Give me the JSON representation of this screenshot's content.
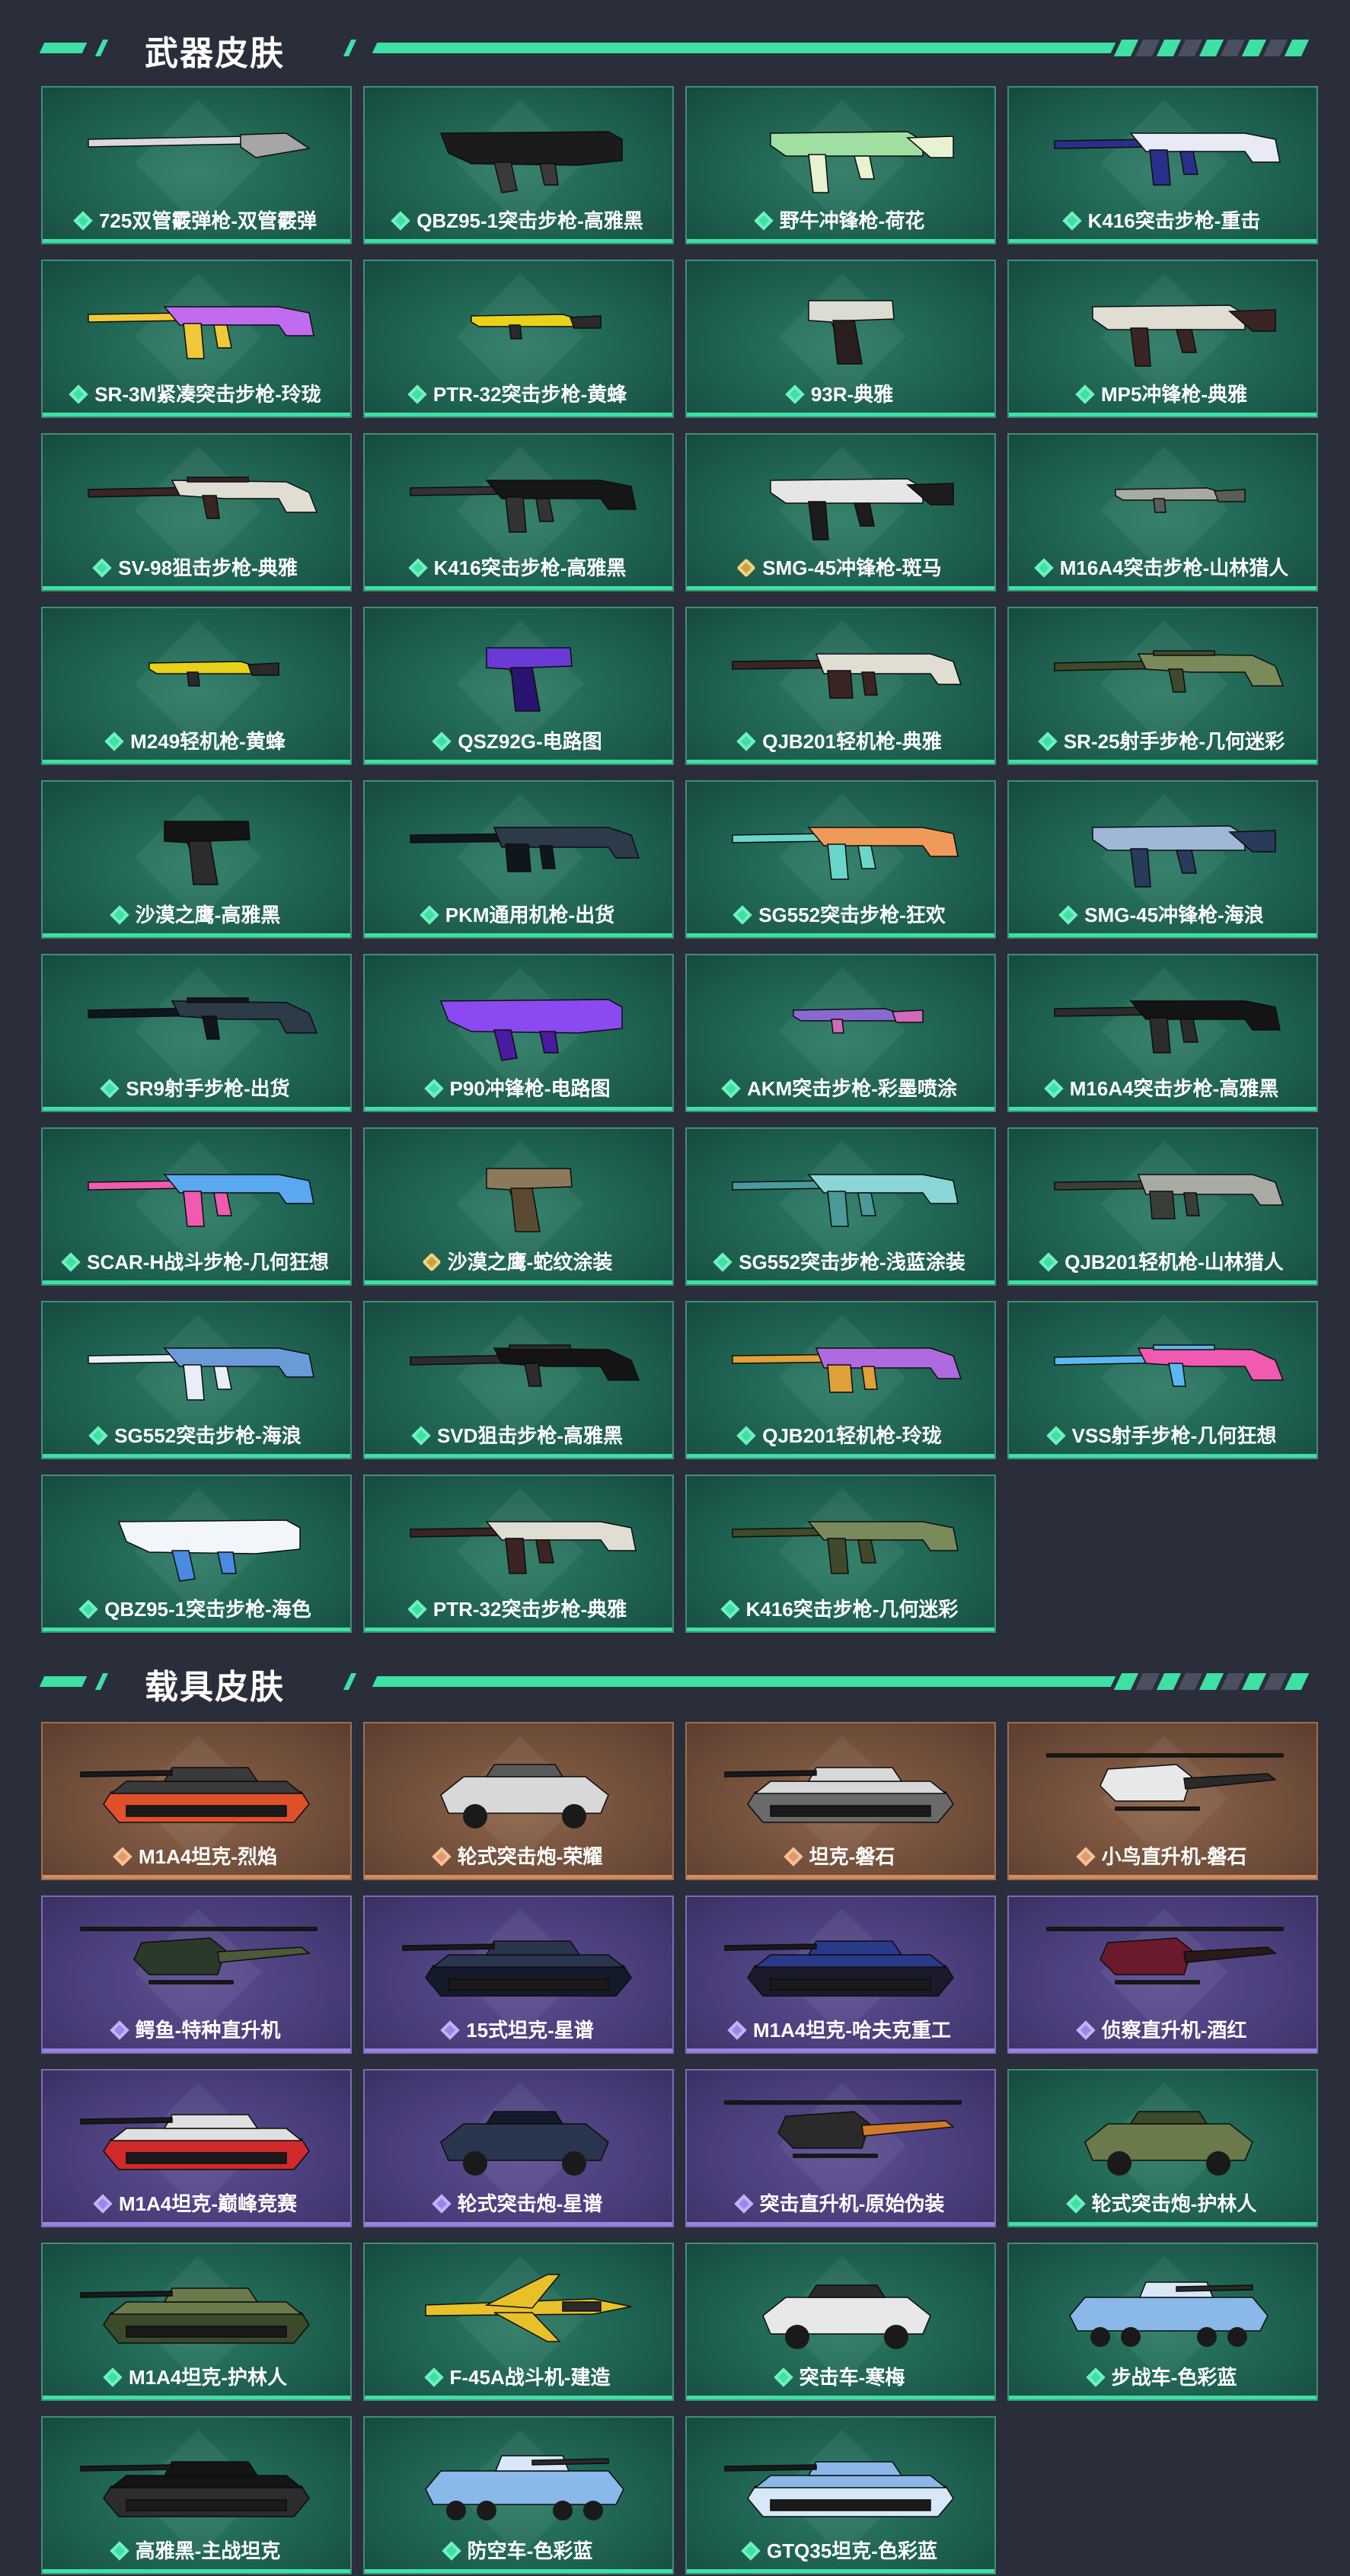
{
  "sections": [
    {
      "title": "武器皮肤",
      "items": [
        {
          "label": "725双管霰弹枪-双管霰弹",
          "rarity": "green",
          "kind": "shotgun",
          "colors": [
            "#d9d9d9",
            "#a6a6a6"
          ]
        },
        {
          "label": "QBZ95-1突击步枪-高雅黑",
          "rarity": "green",
          "kind": "bullpup",
          "colors": [
            "#1b1b1b",
            "#3a3a3a"
          ]
        },
        {
          "label": "野牛冲锋枪-荷花",
          "rarity": "green",
          "kind": "smg",
          "colors": [
            "#9fe0a2",
            "#e9f2d0"
          ]
        },
        {
          "label": "K416突击步枪-重击",
          "rarity": "green",
          "kind": "rifle",
          "colors": [
            "#e8eaf5",
            "#2a2f8a"
          ]
        },
        {
          "label": "SR-3M紧凑突击步枪-玲珑",
          "rarity": "green",
          "kind": "rifle",
          "colors": [
            "#c06bf0",
            "#f0c93a"
          ]
        },
        {
          "label": "PTR-32突击步枪-黄蜂",
          "rarity": "green",
          "kind": "rifle-small",
          "colors": [
            "#e8d21a",
            "#2a2a2a"
          ]
        },
        {
          "label": "93R-典雅",
          "rarity": "green",
          "kind": "pistol",
          "colors": [
            "#dcdcd2",
            "#2b1e1e"
          ]
        },
        {
          "label": "MP5冲锋枪-典雅",
          "rarity": "green",
          "kind": "smg",
          "colors": [
            "#e0ddd2",
            "#3a2424"
          ]
        },
        {
          "label": "SV-98狙击步枪-典雅",
          "rarity": "green",
          "kind": "sniper",
          "colors": [
            "#e0ddd2",
            "#3a2424"
          ]
        },
        {
          "label": "K416突击步枪-高雅黑",
          "rarity": "green",
          "kind": "rifle",
          "colors": [
            "#161616",
            "#333333"
          ]
        },
        {
          "label": "SMG-45冲锋枪-斑马",
          "rarity": "gold",
          "kind": "smg",
          "colors": [
            "#e6e6e6",
            "#1c1c1c"
          ]
        },
        {
          "label": "M16A4突击步枪-山林猎人",
          "rarity": "green",
          "kind": "rifle-small",
          "colors": [
            "#a8aba3",
            "#5a5e58"
          ]
        },
        {
          "label": "M249轻机枪-黄蜂",
          "rarity": "green",
          "kind": "rifle-small",
          "colors": [
            "#e8d21a",
            "#2a2a2a"
          ]
        },
        {
          "label": "QSZ92G-电路图",
          "rarity": "green",
          "kind": "pistol",
          "colors": [
            "#6b3ad6",
            "#2a1470"
          ]
        },
        {
          "label": "QJB201轻机枪-典雅",
          "rarity": "green",
          "kind": "lmg",
          "colors": [
            "#e0ddd2",
            "#3a2424"
          ]
        },
        {
          "label": "SR-25射手步枪-几何迷彩",
          "rarity": "green",
          "kind": "sniper",
          "colors": [
            "#7b8a5a",
            "#3f4a2c"
          ]
        },
        {
          "label": "沙漠之鹰-高雅黑",
          "rarity": "green",
          "kind": "pistol",
          "colors": [
            "#141414",
            "#2c2c2c"
          ]
        },
        {
          "label": "PKM通用机枪-出货",
          "rarity": "green",
          "kind": "lmg",
          "colors": [
            "#2c3a4a",
            "#10161e"
          ]
        },
        {
          "label": "SG552突击步枪-狂欢",
          "rarity": "green",
          "kind": "rifle",
          "colors": [
            "#f09a5a",
            "#6ad6c8"
          ]
        },
        {
          "label": "SMG-45冲锋枪-海浪",
          "rarity": "green",
          "kind": "smg",
          "colors": [
            "#9fb8d8",
            "#2a3a5a"
          ]
        },
        {
          "label": "SR9射手步枪-出货",
          "rarity": "green",
          "kind": "sniper",
          "colors": [
            "#2c3a4a",
            "#10161e"
          ]
        },
        {
          "label": "P90冲锋枪-电路图",
          "rarity": "green",
          "kind": "bullpup",
          "colors": [
            "#8a4af0",
            "#4a1aa0"
          ]
        },
        {
          "label": "AKM突击步枪-彩墨喷涂",
          "rarity": "green",
          "kind": "rifle-small",
          "colors": [
            "#8a6ad0",
            "#d06ab8"
          ]
        },
        {
          "label": "M16A4突击步枪-高雅黑",
          "rarity": "green",
          "kind": "rifle",
          "colors": [
            "#141414",
            "#2c2c2c"
          ]
        },
        {
          "label": "SCAR-H战斗步枪-几何狂想",
          "rarity": "green",
          "kind": "rifle",
          "colors": [
            "#5aa8f0",
            "#f05ab0"
          ]
        },
        {
          "label": "沙漠之鹰-蛇纹涂装",
          "rarity": "gold",
          "kind": "pistol",
          "colors": [
            "#8a7a5a",
            "#5a4a32"
          ]
        },
        {
          "label": "SG552突击步枪-浅蓝涂装",
          "rarity": "green",
          "kind": "rifle",
          "colors": [
            "#8ad6d6",
            "#4a9a9a"
          ]
        },
        {
          "label": "QJB201轻机枪-山林猎人",
          "rarity": "green",
          "kind": "lmg",
          "colors": [
            "#a8aba3",
            "#3a3e38"
          ]
        },
        {
          "label": "SG552突击步枪-海浪",
          "rarity": "green",
          "kind": "rifle",
          "colors": [
            "#6a9ad8",
            "#e8eef8"
          ]
        },
        {
          "label": "SVD狙击步枪-高雅黑",
          "rarity": "green",
          "kind": "sniper",
          "colors": [
            "#141414",
            "#2c2c2c"
          ]
        },
        {
          "label": "QJB201轻机枪-玲珑",
          "rarity": "green",
          "kind": "lmg",
          "colors": [
            "#b06ae0",
            "#e0a03a"
          ]
        },
        {
          "label": "VSS射手步枪-几何狂想",
          "rarity": "green",
          "kind": "sniper",
          "colors": [
            "#f05ab0",
            "#5ab8f0"
          ]
        },
        {
          "label": "QBZ95-1突击步枪-海色",
          "rarity": "green",
          "kind": "bullpup",
          "colors": [
            "#f2f6fb",
            "#4a8ae0"
          ]
        },
        {
          "label": "PTR-32突击步枪-典雅",
          "rarity": "green",
          "kind": "rifle",
          "colors": [
            "#e0ddd2",
            "#3a2424"
          ]
        },
        {
          "label": "K416突击步枪-几何迷彩",
          "rarity": "green",
          "kind": "rifle",
          "colors": [
            "#7b8a5a",
            "#3f4a2c"
          ]
        }
      ]
    },
    {
      "title": "载具皮肤",
      "items": [
        {
          "label": "M1A4坦克-烈焰",
          "rarity": "orange",
          "kind": "tank",
          "colors": [
            "#3a3a3a",
            "#e0502a"
          ]
        },
        {
          "label": "轮式突击炮-荣耀",
          "rarity": "orange",
          "kind": "car",
          "colors": [
            "#d8d8d8",
            "#5a5a5a"
          ]
        },
        {
          "label": "坦克-磐石",
          "rarity": "orange",
          "kind": "tank",
          "colors": [
            "#d8d8d8",
            "#6a6a6a"
          ]
        },
        {
          "label": "小鸟直升机-磐石",
          "rarity": "orange",
          "kind": "heli",
          "colors": [
            "#e8e8e8",
            "#2a2a2a"
          ]
        },
        {
          "label": "鳄鱼-特种直升机",
          "rarity": "purple",
          "kind": "heli",
          "colors": [
            "#2a3a2a",
            "#4a5a3a"
          ]
        },
        {
          "label": "15式坦克-星谱",
          "rarity": "purple",
          "kind": "tank",
          "colors": [
            "#2a3550",
            "#141a2a"
          ]
        },
        {
          "label": "M1A4坦克-哈夫克重工",
          "rarity": "purple",
          "kind": "tank",
          "colors": [
            "#2a3a8a",
            "#1a1a2a"
          ]
        },
        {
          "label": "侦察直升机-酒红",
          "rarity": "purple",
          "kind": "heli",
          "colors": [
            "#6a1a2a",
            "#2a1a1a"
          ]
        },
        {
          "label": "M1A4坦克-巅峰竞赛",
          "rarity": "purple",
          "kind": "tank",
          "colors": [
            "#e0e0e0",
            "#d02a2a"
          ]
        },
        {
          "label": "轮式突击炮-星谱",
          "rarity": "purple",
          "kind": "car",
          "colors": [
            "#2a3550",
            "#141a2a"
          ]
        },
        {
          "label": "突击直升机-原始伪装",
          "rarity": "purple",
          "kind": "heli",
          "colors": [
            "#2a2a2a",
            "#d07a2a"
          ]
        },
        {
          "label": "轮式突击炮-护林人",
          "rarity": "green",
          "kind": "car",
          "colors": [
            "#6a7a4a",
            "#3a4a2a"
          ]
        },
        {
          "label": "M1A4坦克-护林人",
          "rarity": "green",
          "kind": "tank",
          "colors": [
            "#6a7a4a",
            "#3a4a2a"
          ]
        },
        {
          "label": "F-45A战斗机-建造",
          "rarity": "green",
          "kind": "jet",
          "colors": [
            "#e8c02a",
            "#2a2a2a"
          ]
        },
        {
          "label": "突击车-寒梅",
          "rarity": "green",
          "kind": "car",
          "colors": [
            "#e8e8e8",
            "#2a2a2a"
          ]
        },
        {
          "label": "步战车-色彩蓝",
          "rarity": "green",
          "kind": "ifv",
          "colors": [
            "#8ab8e8",
            "#d8e8f8"
          ]
        },
        {
          "label": "高雅黑-主战坦克",
          "rarity": "green",
          "kind": "tank",
          "colors": [
            "#141414",
            "#2c2c2c"
          ]
        },
        {
          "label": "防空车-色彩蓝",
          "rarity": "green",
          "kind": "ifv",
          "colors": [
            "#8ab8e8",
            "#d8e8f8"
          ]
        },
        {
          "label": "GTQ35坦克-色彩蓝",
          "rarity": "green",
          "kind": "tank",
          "colors": [
            "#8ab8e8",
            "#d8e8f8"
          ]
        }
      ]
    }
  ]
}
